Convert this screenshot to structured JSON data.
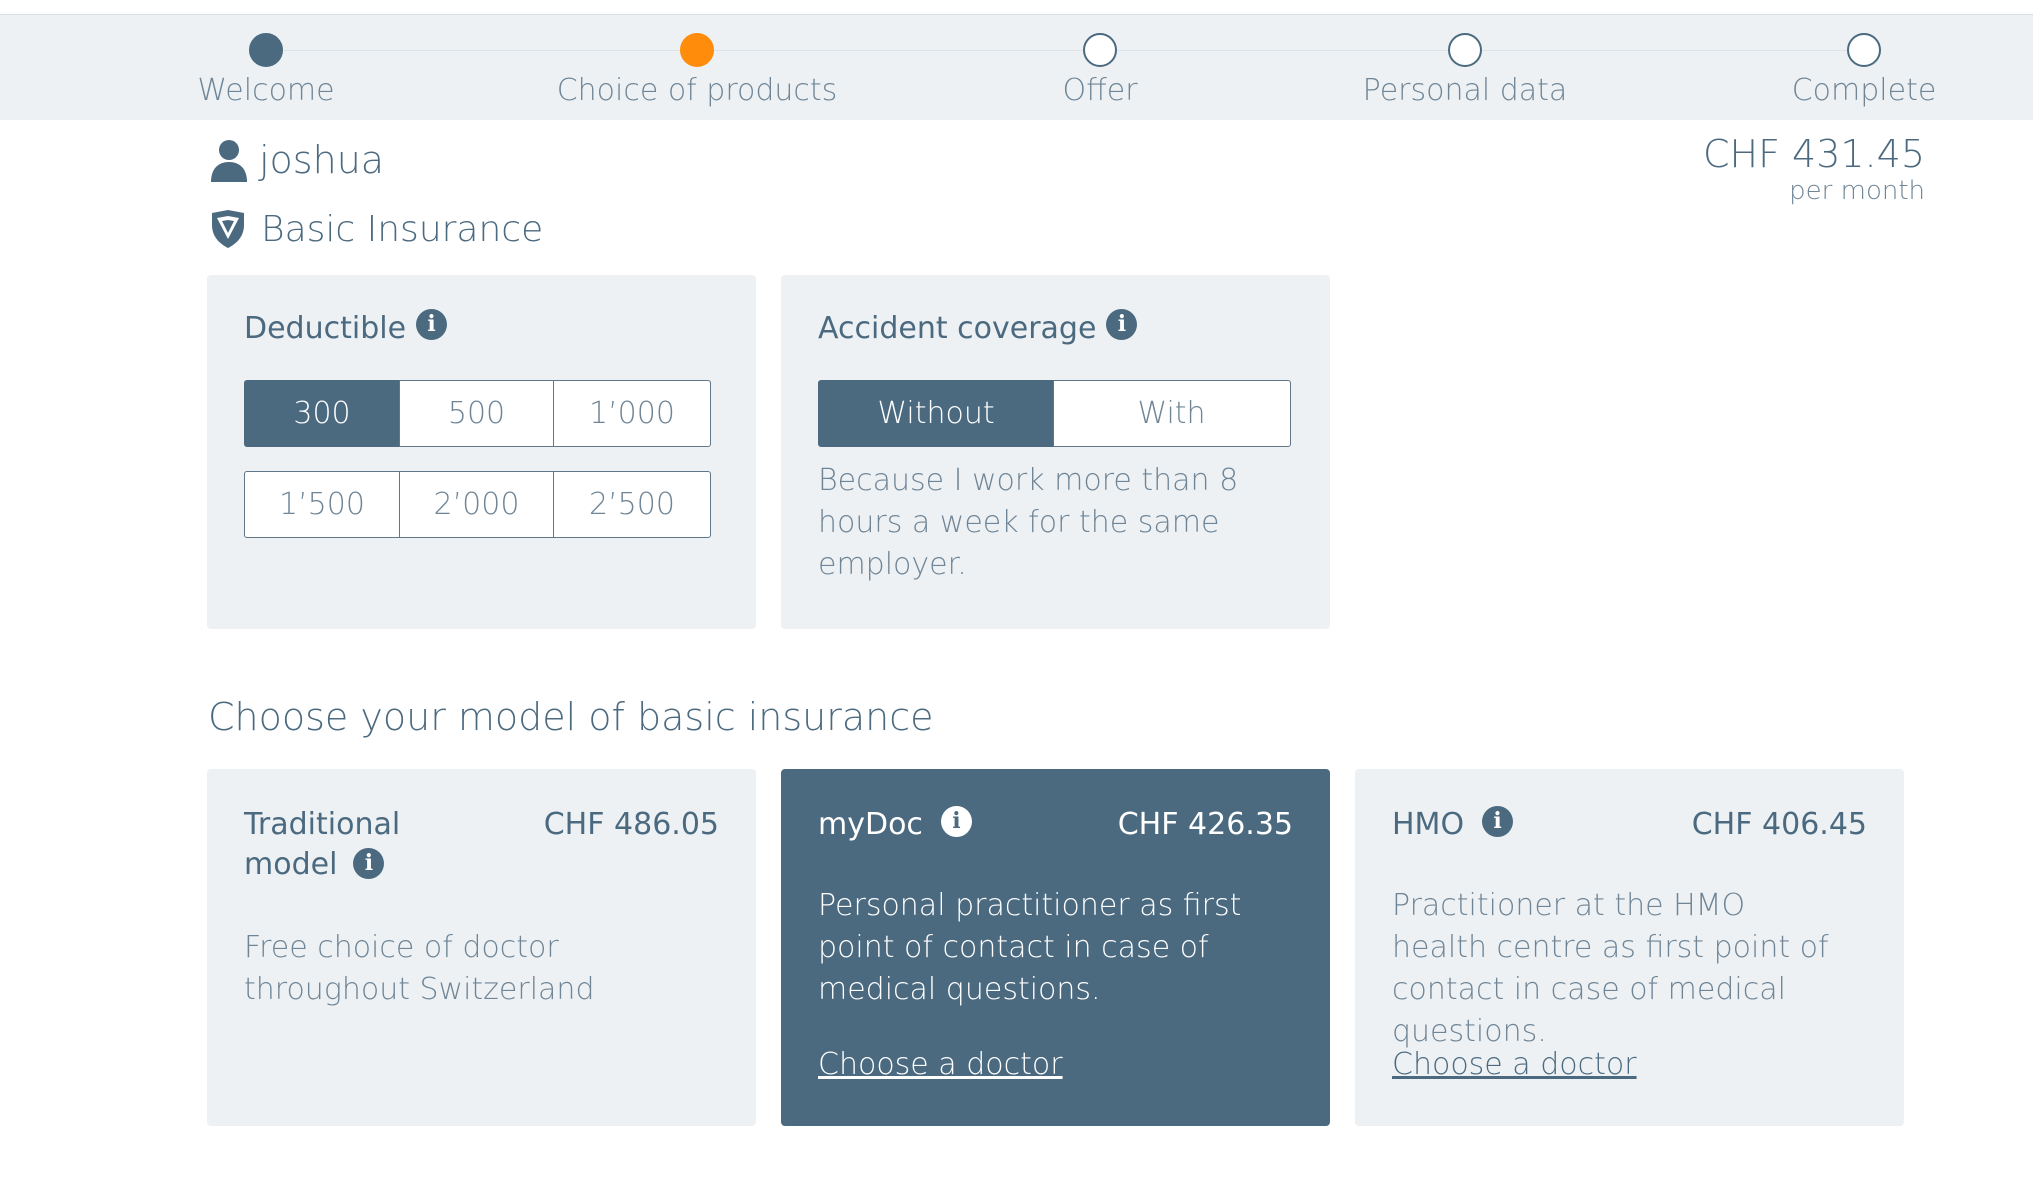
{
  "stepper": {
    "steps": [
      {
        "label": "Welcome",
        "state": "done"
      },
      {
        "label": "Choice of products",
        "state": "active"
      },
      {
        "label": "Offer",
        "state": "todo"
      },
      {
        "label": "Personal data",
        "state": "todo"
      },
      {
        "label": "Complete",
        "state": "todo"
      }
    ]
  },
  "user": {
    "name": "joshua",
    "icon": "user-icon"
  },
  "premium": {
    "amount": "CHF 431.45",
    "period": "per month"
  },
  "section": {
    "title": "Basic Insurance",
    "icon": "shield-icon"
  },
  "deductible": {
    "title": "Deductible",
    "info_icon": "i",
    "options": [
      "300",
      "500",
      "1’000",
      "1’500",
      "2’000",
      "2’500"
    ],
    "selected": "300"
  },
  "accident": {
    "title": "Accident coverage",
    "info_icon": "i",
    "options": [
      "Without",
      "With"
    ],
    "selected": "Without",
    "note": "Because I work more than 8 hours a week for the same employer."
  },
  "models": {
    "heading": "Choose your model of basic insurance",
    "cards": [
      {
        "name_line1": "Traditional",
        "name_line2": "model",
        "price": "CHF 486.05",
        "description": "Free choice of doctor throughout Switzerland",
        "link": "",
        "info_icon": "i"
      },
      {
        "name_line1": "myDoc",
        "name_line2": "",
        "price": "CHF 426.35",
        "description": "Personal practitioner as first point of contact in case of medical questions.",
        "link": "Choose a doctor",
        "info_icon": "i"
      },
      {
        "name_line1": "HMO",
        "name_line2": "",
        "price": "CHF 406.45",
        "description": "Practitioner at the HMO health centre as first point of contact in case of medical questions.",
        "link": "Choose a doctor",
        "info_icon": "i"
      }
    ],
    "selected": "myDoc"
  },
  "colors": {
    "accent": "#4b6a80",
    "active_step": "#ff8c0a",
    "panel": "#edf1f4"
  }
}
